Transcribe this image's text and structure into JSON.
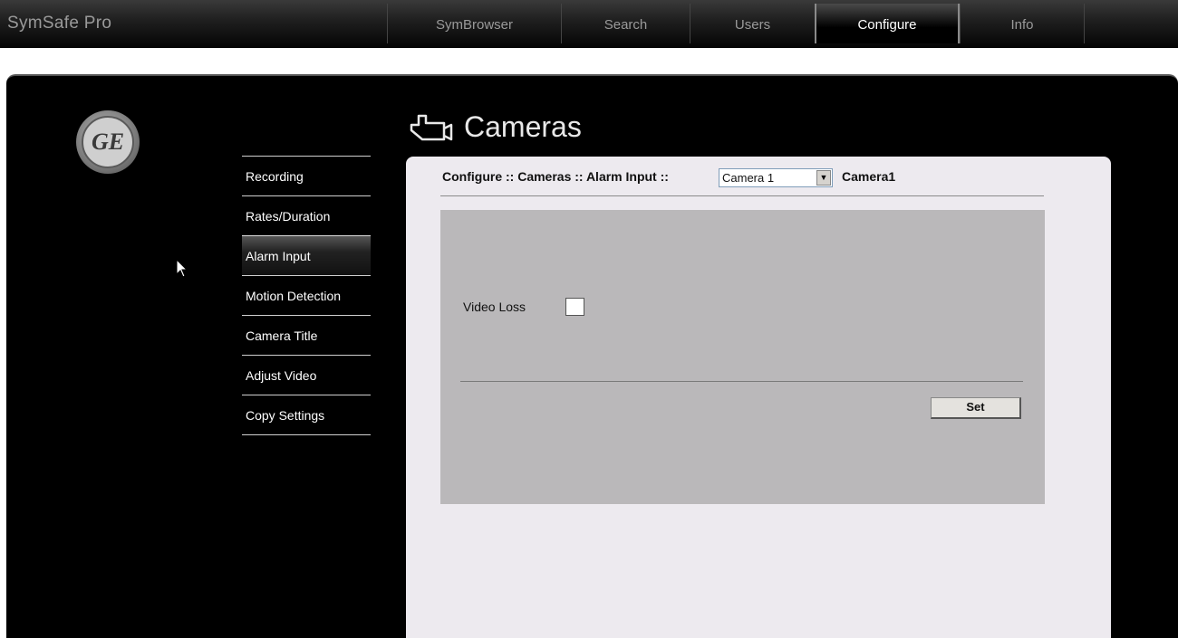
{
  "app": {
    "title": "SymSafe Pro"
  },
  "nav": {
    "tabs": [
      {
        "label": "SymBrowser"
      },
      {
        "label": "Search"
      },
      {
        "label": "Users"
      },
      {
        "label": "Configure",
        "active": true
      },
      {
        "label": "Info"
      }
    ]
  },
  "logo": {
    "text": "GE"
  },
  "sidebar": {
    "items": [
      {
        "label": "Recording"
      },
      {
        "label": "Rates/Duration"
      },
      {
        "label": "Alarm Input",
        "active": true
      },
      {
        "label": "Motion Detection"
      },
      {
        "label": "Camera Title"
      },
      {
        "label": "Adjust Video"
      },
      {
        "label": "Copy Settings"
      }
    ]
  },
  "page": {
    "title": "Cameras",
    "icon": "camera-icon"
  },
  "content": {
    "breadcrumb": "Configure :: Cameras :: Alarm Input ::",
    "camera_select": {
      "value": "Camera 1"
    },
    "camera_name": "Camera1",
    "video_loss": {
      "label": "Video Loss",
      "checked": false
    },
    "set_label": "Set"
  },
  "colors": {
    "background": "#000000",
    "panel": "#edeaef",
    "box": "#bab8ba",
    "active_tab_border": "#8a8a8a"
  }
}
